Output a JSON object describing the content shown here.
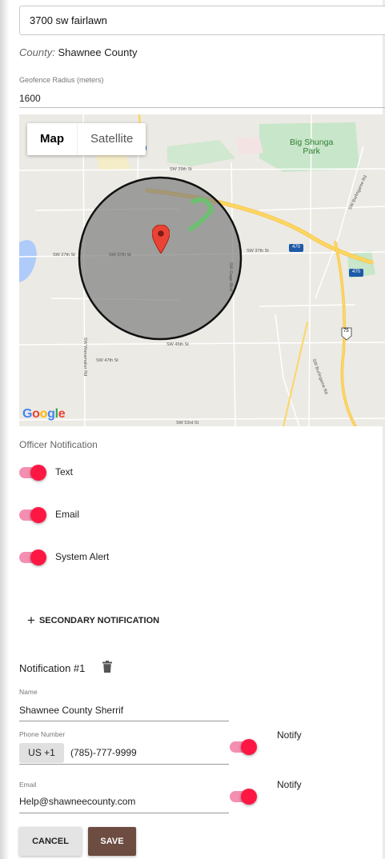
{
  "address": {
    "value": "3700 sw fairlawn"
  },
  "county": {
    "label": "County:",
    "value": "Shawnee County"
  },
  "geofence": {
    "label": "Geofence Radius (meters)",
    "value": "1600"
  },
  "map": {
    "type_map": "Map",
    "type_satellite": "Satellite",
    "park_label": "Big Shunga\nPark",
    "google_logo": [
      "G",
      "o",
      "o",
      "g",
      "l",
      "e"
    ],
    "google_colors": [
      "#4285F4",
      "#EA4335",
      "#FBBC05",
      "#4285F4",
      "#34A853",
      "#EA4335"
    ],
    "roads": [
      "SW 29th St",
      "SW 27th St",
      "SW 37th St",
      "SW 37th St",
      "SW Gage Blvd",
      "SW 45th St",
      "SW 47th St",
      "SW Wanamaker Rd",
      "SW 53rd St",
      "SW Burlingame Rd",
      "SW Burlingame Rd",
      "470",
      "470",
      "75"
    ]
  },
  "officer_notification": {
    "title": "Officer Notification",
    "toggles": [
      {
        "label": "Text",
        "on": true
      },
      {
        "label": "Email",
        "on": true
      },
      {
        "label": "System Alert",
        "on": true
      }
    ]
  },
  "secondary_button": {
    "icon": "plus-icon",
    "label": "SECONDARY NOTIFICATION"
  },
  "notification1": {
    "title": "Notification #1",
    "delete_icon": "trash-icon",
    "name": {
      "label": "Name",
      "value": "Shawnee County Sherrif"
    },
    "phone": {
      "label": "Phone Number",
      "country": "US +1",
      "value": "(785)-777-9999",
      "notify_label": "Notify",
      "notify_on": true
    },
    "email": {
      "label": "Email",
      "value": "Help@shawneecounty.com",
      "notify_label": "Notify",
      "notify_on": true
    }
  },
  "actions": {
    "cancel": "CANCEL",
    "save": "SAVE"
  },
  "colors": {
    "accent": "#ff1744",
    "accent_track": "#f48fb1",
    "save_bg": "#6d4c41",
    "park": "#c8e6c9",
    "highway": "#fdd663"
  }
}
